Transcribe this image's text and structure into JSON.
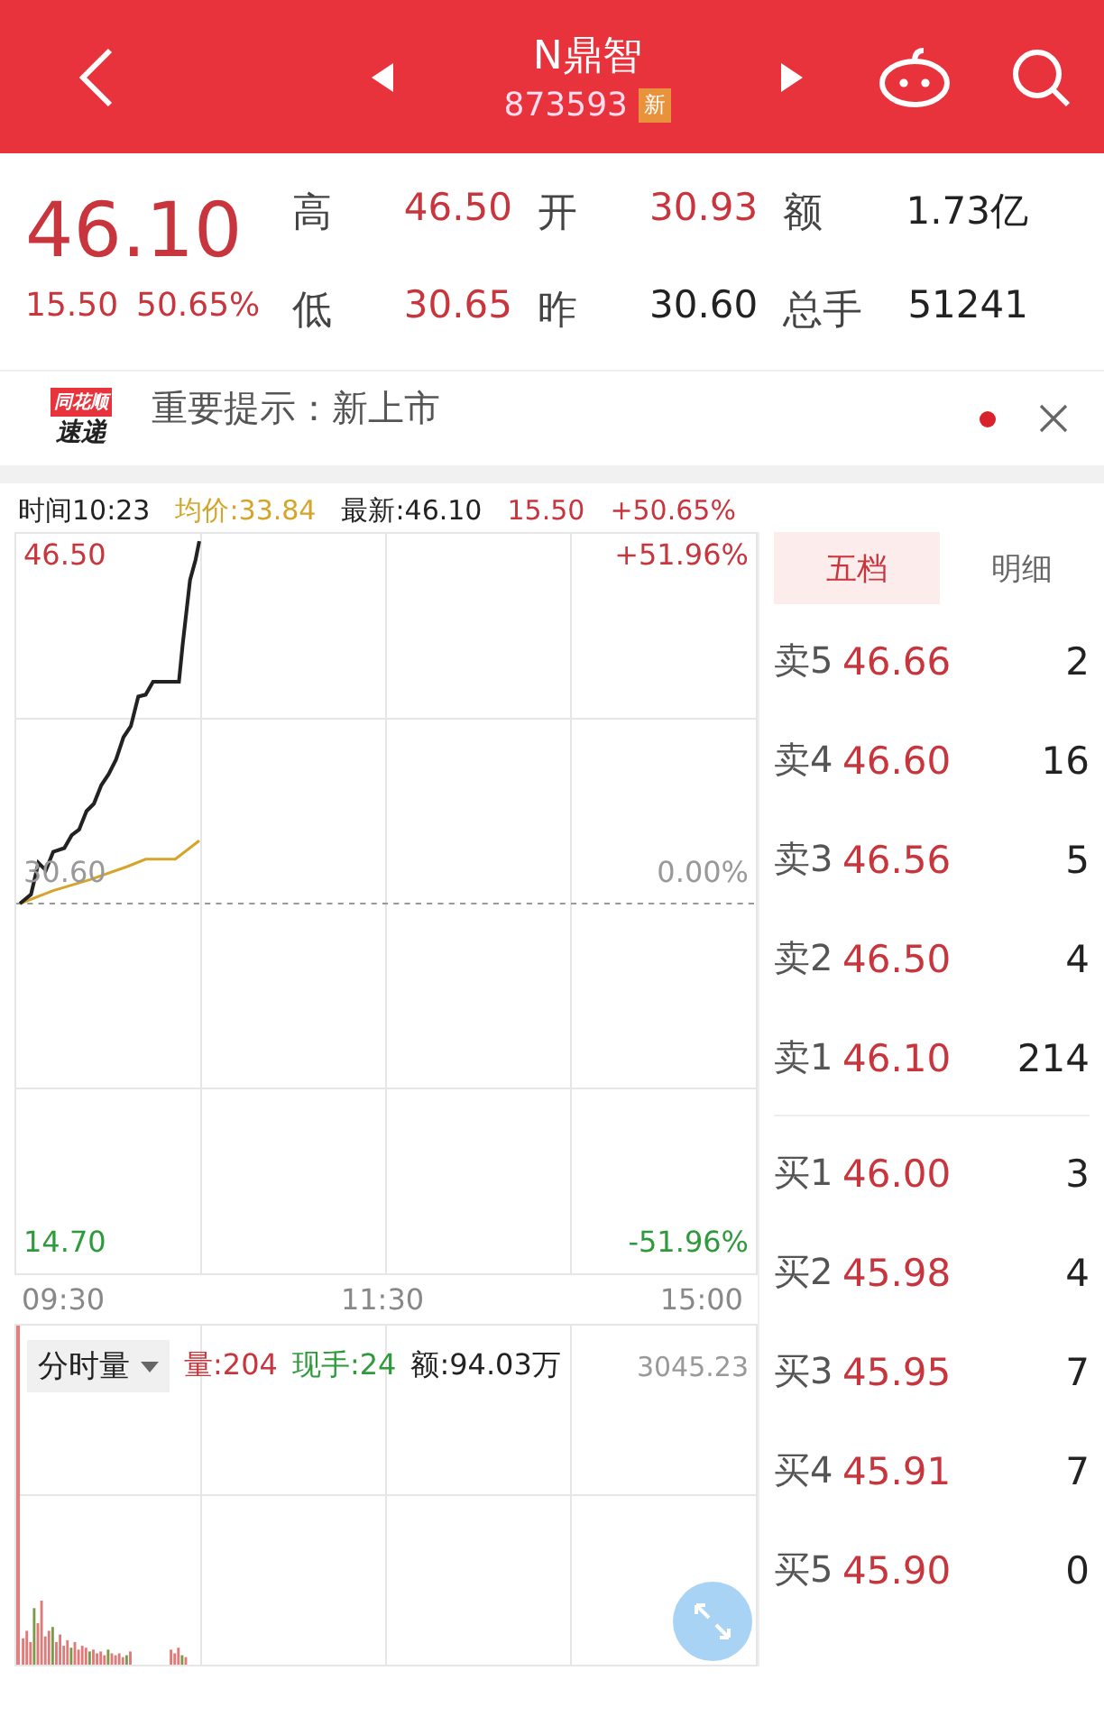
{
  "header": {
    "title": "N鼎智",
    "code": "873593",
    "badge": "新"
  },
  "quote": {
    "price": "46.10",
    "change": "15.50",
    "change_pct": "50.65%",
    "stats": [
      {
        "label": "高",
        "value": "46.50",
        "kind": "up"
      },
      {
        "label": "开",
        "value": "30.93",
        "kind": "up"
      },
      {
        "label": "额",
        "value": "1.73亿",
        "kind": "plain"
      },
      {
        "label": "低",
        "value": "30.65",
        "kind": "up"
      },
      {
        "label": "昨",
        "value": "30.60",
        "kind": "plain"
      },
      {
        "label": "总手",
        "value": "51241",
        "kind": "plain"
      }
    ]
  },
  "notice": {
    "logo_top": "同花顺",
    "logo_bottom": "速递",
    "text": "重要提示：新上市",
    "unread": true
  },
  "chart_header": [
    {
      "text": "时间10:23",
      "kind": "plain"
    },
    {
      "text": "均价:33.84",
      "kind": "avg"
    },
    {
      "text": "最新:46.10",
      "kind": "plain"
    },
    {
      "text": "15.50",
      "kind": "up"
    },
    {
      "text": "+50.65%",
      "kind": "up"
    }
  ],
  "price_chart": {
    "high": "46.50",
    "mid": "30.60",
    "low": "14.70",
    "pct_high": "+51.96%",
    "pct_mid": "0.00%",
    "pct_low": "-51.96%",
    "times": [
      "09:30",
      "11:30",
      "15:00"
    ]
  },
  "volume": {
    "selector": "分时量",
    "indicators": [
      {
        "text": "量:204",
        "kind": "up"
      },
      {
        "text": "现手:24",
        "kind": "down"
      },
      {
        "text": "额:94.03万",
        "kind": "plain"
      }
    ],
    "scale": "3045.23"
  },
  "order_book": {
    "tabs": [
      {
        "label": "五档",
        "selected": true
      },
      {
        "label": "明细",
        "selected": false
      }
    ],
    "asks": [
      {
        "label": "卖5",
        "price": "46.66",
        "volume": "2"
      },
      {
        "label": "卖4",
        "price": "46.60",
        "volume": "16"
      },
      {
        "label": "卖3",
        "price": "46.56",
        "volume": "5"
      },
      {
        "label": "卖2",
        "price": "46.50",
        "volume": "4"
      },
      {
        "label": "卖1",
        "price": "46.10",
        "volume": "214"
      }
    ],
    "bids": [
      {
        "label": "买1",
        "price": "46.00",
        "volume": "3"
      },
      {
        "label": "买2",
        "price": "45.98",
        "volume": "4"
      },
      {
        "label": "买3",
        "price": "45.95",
        "volume": "7"
      },
      {
        "label": "买4",
        "price": "45.91",
        "volume": "7"
      },
      {
        "label": "买5",
        "price": "45.90",
        "volume": "0"
      }
    ]
  }
}
